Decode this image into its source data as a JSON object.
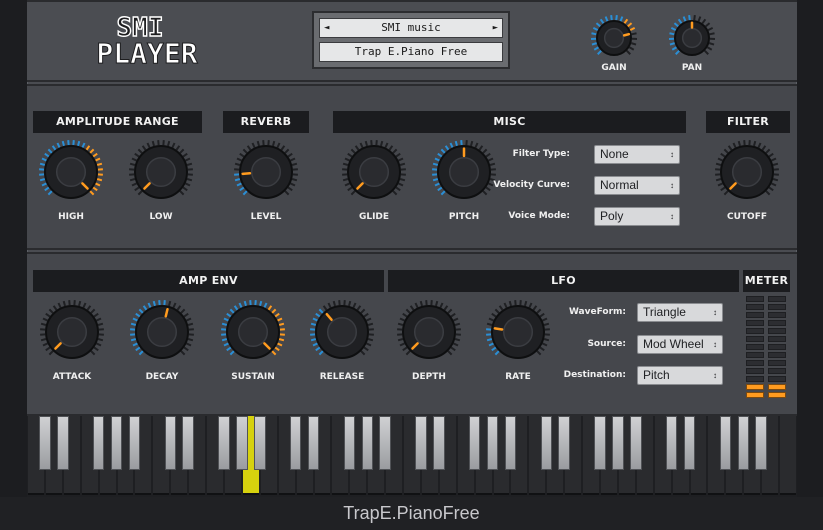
{
  "app": {
    "logo_top": "SMI",
    "logo_bottom": "PLAYER",
    "instrument_group": "SMI music",
    "instrument_name": "Trap E.Piano Free",
    "prev_label": "◄",
    "next_label": "►"
  },
  "top_knobs": [
    {
      "label": "GAIN",
      "value": 0.78
    },
    {
      "label": "PAN",
      "value": 0.5
    }
  ],
  "sections": {
    "amplitude_range": "AMPLITUDE RANGE",
    "reverb": "REVERB",
    "misc": "MISC",
    "filter": "FILTER",
    "amp_env": "AMP ENV",
    "lfo": "LFO",
    "meter": "METER"
  },
  "row1_knobs": [
    {
      "label": "HIGH",
      "value": 1.0
    },
    {
      "label": "LOW",
      "value": 0.0
    },
    {
      "label": "LEVEL",
      "value": 0.15
    },
    {
      "label": "GLIDE",
      "value": 0.0
    },
    {
      "label": "PITCH",
      "value": 0.5
    },
    {
      "label": "CUTOFF",
      "value": 0.0
    }
  ],
  "misc_params": [
    {
      "label": "Filter Type:",
      "value": "None"
    },
    {
      "label": "Velocity Curve:",
      "value": "Normal"
    },
    {
      "label": "Voice Mode:",
      "value": "Poly"
    }
  ],
  "row2_knobs": [
    {
      "label": "ATTACK",
      "value": 0.0
    },
    {
      "label": "DECAY",
      "value": 0.55
    },
    {
      "label": "SUSTAIN",
      "value": 1.0
    },
    {
      "label": "RELEASE",
      "value": 0.35
    },
    {
      "label": "DEPTH",
      "value": 0.0
    },
    {
      "label": "RATE",
      "value": 0.2
    }
  ],
  "lfo_params": [
    {
      "label": "WaveForm:",
      "value": "Triangle"
    },
    {
      "label": "Source:",
      "value": "Mod Wheel"
    },
    {
      "label": "Destination:",
      "value": "Pitch"
    }
  ],
  "meter": {
    "active_rows": 2,
    "total_rows": 13
  },
  "keyboard": {
    "white_keys": 43,
    "pressed_white_key": 12,
    "pressed_color": "#d6d10e"
  },
  "colors": {
    "accent_orange": "#ff9b1f",
    "accent_blue": "#2a8fd6",
    "panel": "#45474c",
    "header": "#1b1c1f"
  },
  "footer": {
    "title": "TrapE.PianoFree"
  }
}
